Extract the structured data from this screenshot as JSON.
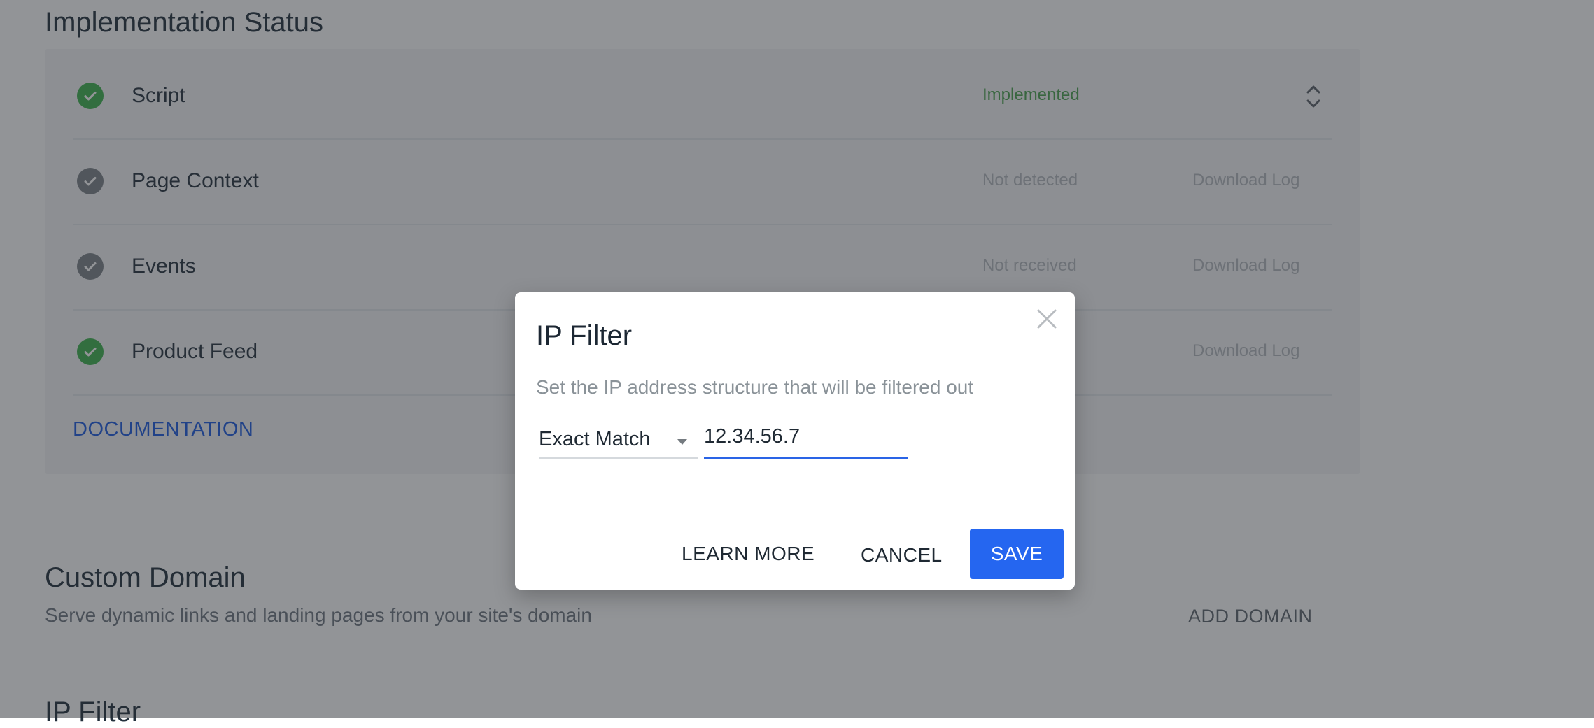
{
  "implementation": {
    "title": "Implementation Status",
    "rows": [
      {
        "label": "Script",
        "status": "Implemented",
        "action": ""
      },
      {
        "label": "Page Context",
        "status": "Not detected",
        "action": "Download Log"
      },
      {
        "label": "Events",
        "status": "Not received",
        "action": "Download Log"
      },
      {
        "label": "Product Feed",
        "status": "",
        "action": "Download Log"
      }
    ],
    "documentation_link": "DOCUMENTATION"
  },
  "custom_domain": {
    "title": "Custom Domain",
    "subtitle": "Serve dynamic links and landing pages from your site's domain",
    "add_button": "ADD DOMAIN"
  },
  "ip_filter_section": {
    "title": "IP Filter"
  },
  "dialog": {
    "title": "IP Filter",
    "description": "Set the IP address structure that will be filtered out",
    "match_select": "Exact Match",
    "ip_value": "12.34.56.7",
    "learn_more": "LEARN MORE",
    "cancel": "CANCEL",
    "save": "SAVE"
  },
  "colors": {
    "accent": "#2566f0",
    "success": "#3fb34f",
    "link": "#1d5be0"
  },
  "icons": {
    "check": "check-circle-icon",
    "close": "close-icon",
    "sort": "sort-icon",
    "caret": "chevron-down-icon"
  }
}
